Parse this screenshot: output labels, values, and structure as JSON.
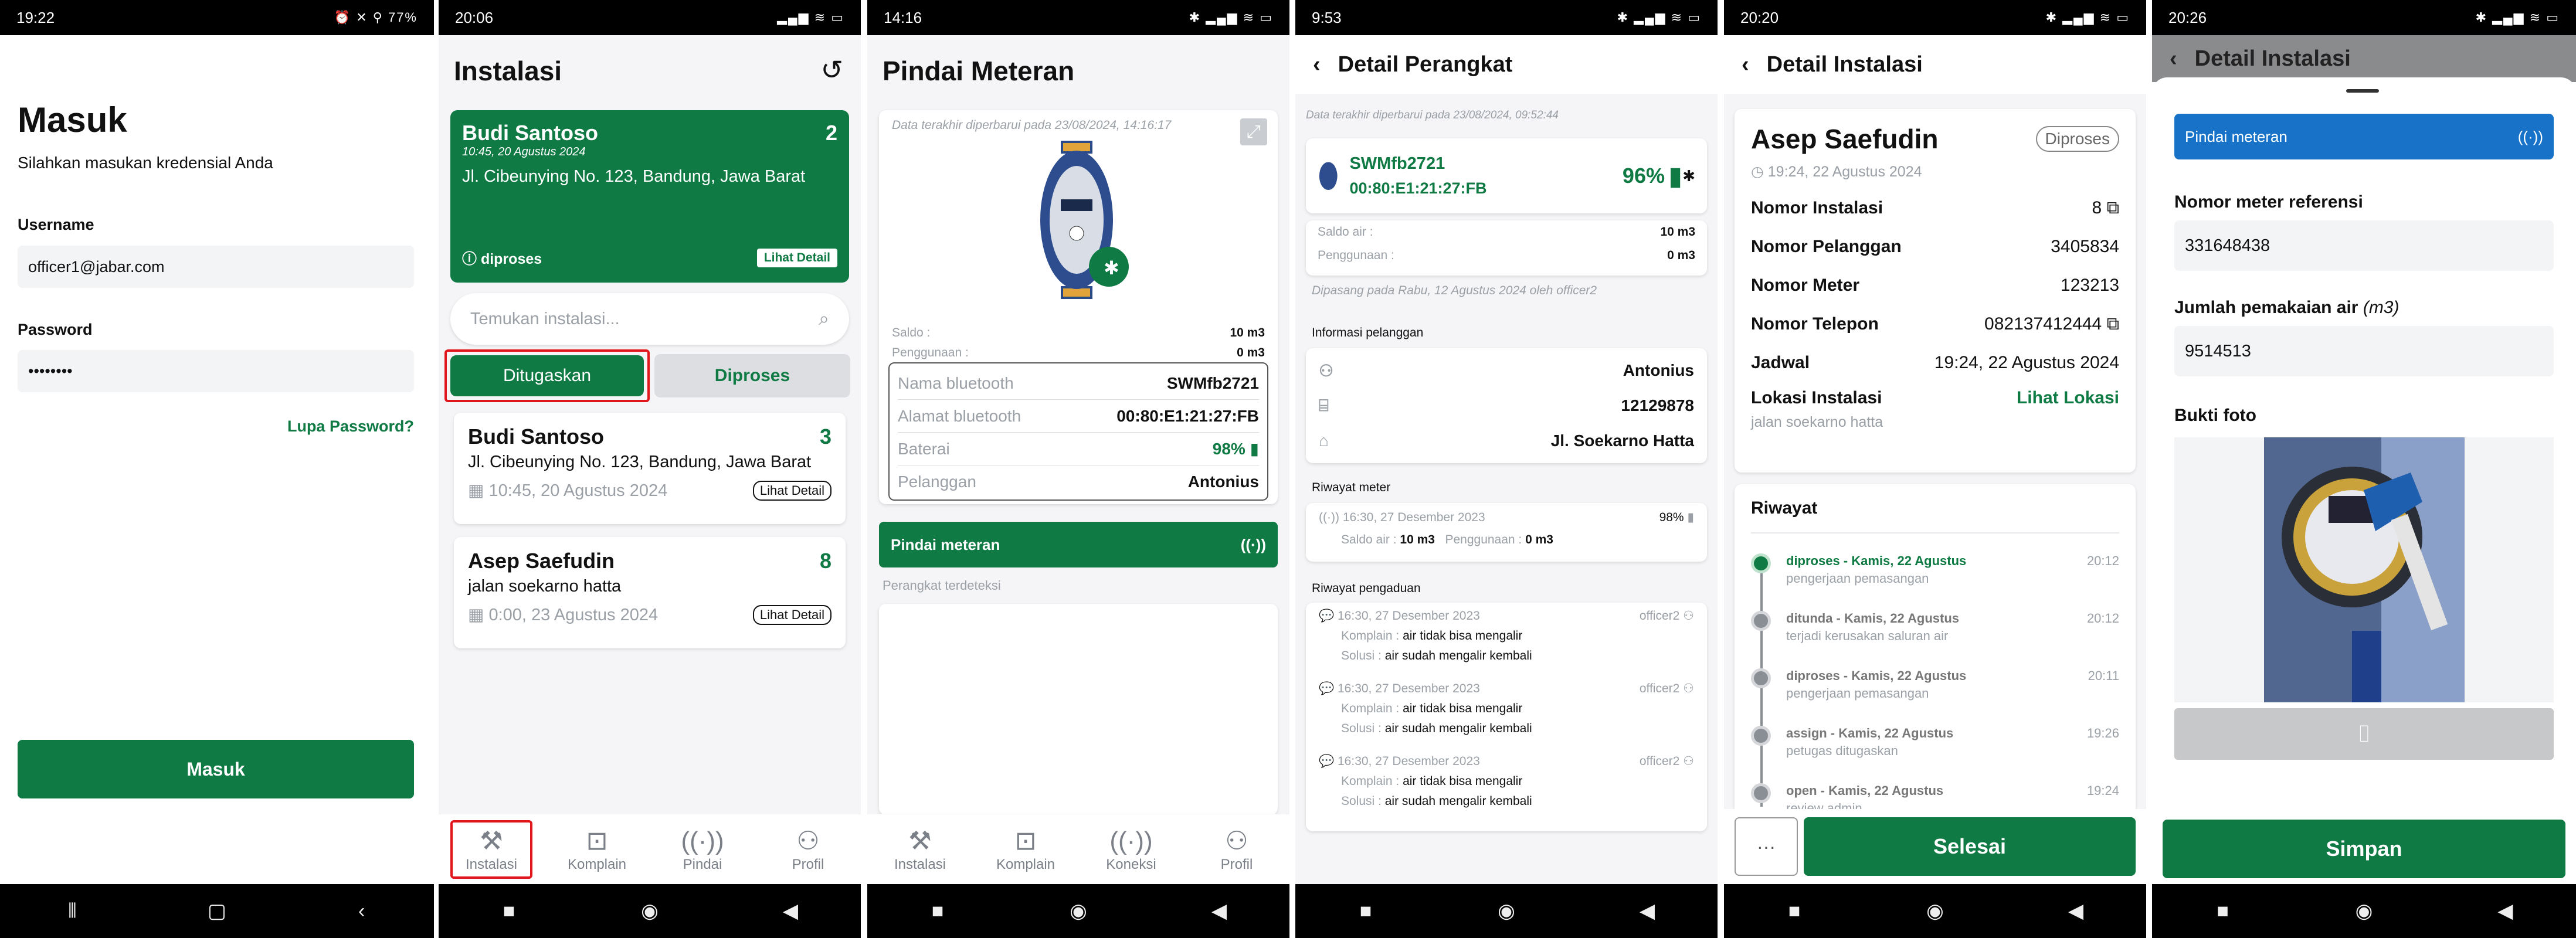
{
  "s1": {
    "time": "19:22",
    "status_right": "⏰ ✕ ⚲ 77%",
    "title": "Masuk",
    "subtitle": "Silahkan masukan kredensial Anda",
    "username_label": "Username",
    "username_value": "officer1@jabar.com",
    "password_label": "Password",
    "password_value": "••••••••",
    "forgot": "Lupa Password?",
    "login_button": "Masuk"
  },
  "s2": {
    "time": "20:06",
    "status_right": "▂▄▆ ≋ ▭",
    "title": "Instalasi",
    "hero": {
      "name": "Budi Santoso",
      "count": "2",
      "datetime": "10:45, 20 Agustus 2024",
      "address": "Jl. Cibeunying No. 123, Bandung, Jawa Barat",
      "status": "diproses",
      "detail": "Lihat Detail"
    },
    "search_placeholder": "Temukan instalasi...",
    "tab_active": "Ditugaskan",
    "tab_inactive": "Diproses",
    "items": [
      {
        "name": "Budi Santoso",
        "count": "3",
        "address": "Jl. Cibeunying No. 123, Bandung, Jawa Barat",
        "datetime": "10:45, 20 Agustus 2024",
        "detail": "Lihat Detail"
      },
      {
        "name": "Asep Saefudin",
        "count": "8",
        "address": "jalan soekarno hatta",
        "datetime": "0:00, 23 Agustus 2024",
        "detail": "Lihat Detail"
      }
    ],
    "tabs": [
      "Instalasi",
      "Komplain",
      "Pindai",
      "Profil"
    ]
  },
  "s3": {
    "time": "14:16",
    "status_right": "✱ ▂▄▆ ≋ ▭",
    "title": "Pindai Meteran",
    "updated": "Data terakhir diperbarui pada 23/08/2024, 14:16:17",
    "saldo_label": "Saldo :",
    "saldo_value": "10 m3",
    "penggunaan_label": "Penggunaan :",
    "penggunaan_value": "0 m3",
    "rows": [
      {
        "k": "Nama bluetooth",
        "v": "SWMfb2721"
      },
      {
        "k": "Alamat bluetooth",
        "v": "00:80:E1:21:27:FB"
      },
      {
        "k": "Baterai",
        "v": "98%"
      },
      {
        "k": "Pelanggan",
        "v": "Antonius"
      }
    ],
    "scan_button": "Pindai meteran",
    "detected": "Perangkat terdeteksi",
    "tabs": [
      "Instalasi",
      "Komplain",
      "Koneksi",
      "Profil"
    ]
  },
  "s4": {
    "time": "9:53",
    "status_right": "✱ ▂▄▆ ≋ ▭",
    "title": "Detail Perangkat",
    "updated": "Data terakhir diperbarui pada 23/08/2024, 09:52:44",
    "device_name": "SWMfb2721",
    "device_mac": "00:80:E1:21:27:FB",
    "battery": "96%",
    "saldo_label": "Saldo air :",
    "saldo_value": "10 m3",
    "penggunaan_label": "Penggunaan :",
    "penggunaan_value": "0 m3",
    "installed": "Dipasang pada Rabu, 12 Agustus 2024 oleh officer2",
    "cust_header": "Informasi pelanggan",
    "cust": [
      "Antonius",
      "12129878",
      "Jl. Soekarno Hatta"
    ],
    "meter_header": "Riwayat meter",
    "meter": {
      "when": "16:30, 27 Desember 2023",
      "pct": "98%",
      "saldo": "Saldo air :",
      "saldo_v": "10 m3",
      "peng": "Penggunaan :",
      "peng_v": "0 m3"
    },
    "compl_header": "Riwayat pengaduan",
    "complaints": [
      {
        "when": "16:30, 27 Desember 2023",
        "who": "officer2",
        "k": "Komplain :",
        "kv": "air tidak bisa mengalir",
        "s": "Solusi :",
        "sv": "air sudah mengalir kembali"
      },
      {
        "when": "16:30, 27 Desember 2023",
        "who": "officer2",
        "k": "Komplain :",
        "kv": "air tidak bisa mengalir",
        "s": "Solusi :",
        "sv": "air sudah mengalir kembali"
      },
      {
        "when": "16:30, 27 Desember 2023",
        "who": "officer2",
        "k": "Komplain :",
        "kv": "air tidak bisa mengalir",
        "s": "Solusi :",
        "sv": "air sudah mengalir kembali"
      }
    ]
  },
  "s5": {
    "time": "20:20",
    "status_right": "✱ ▂▄▆ ≋ ▭",
    "title": "Detail Instalasi",
    "name": "Asep Saefudin",
    "badge": "Diproses",
    "datetime": "19:24, 22 Agustus 2024",
    "rows": [
      {
        "k": "Nomor Instalasi",
        "v": "8"
      },
      {
        "k": "Nomor Pelanggan",
        "v": "3405834"
      },
      {
        "k": "Nomor Meter",
        "v": "123213"
      },
      {
        "k": "Nomor Telepon",
        "v": "082137412444"
      },
      {
        "k": "Jadwal",
        "v": "19:24, 22 Agustus 2024"
      }
    ],
    "loc_label": "Lokasi Instalasi",
    "loc_link": "Lihat Lokasi",
    "loc_value": "jalan soekarno hatta",
    "history_title": "Riwayat",
    "history": [
      {
        "t": "diproses - Kamis, 22 Agustus",
        "d": "pengerjaan pemasangan",
        "time": "20:12"
      },
      {
        "t": "ditunda - Kamis, 22 Agustus",
        "d": "terjadi kerusakan saluran air",
        "time": "20:12"
      },
      {
        "t": "diproses - Kamis, 22 Agustus",
        "d": "pengerjaan pemasangan",
        "time": "20:11"
      },
      {
        "t": "assign - Kamis, 22 Agustus",
        "d": "petugas ditugaskan",
        "time": "19:26"
      },
      {
        "t": "open - Kamis, 22 Agustus",
        "d": "review admin",
        "time": "19:24"
      }
    ],
    "more": "···",
    "done": "Selesai"
  },
  "s6": {
    "time": "20:26",
    "status_right": "✱ ▂▄▆ ≋ ▭",
    "title": "Detail Instalasi",
    "scan": "Pindai meteran",
    "ref_label": "Nomor meter referensi",
    "ref_value": "331648438",
    "usage_label": "Jumlah pemakaian air",
    "usage_unit": "(m3)",
    "usage_value": "9514513",
    "photo_label": "Bukti foto",
    "save": "Simpan"
  }
}
